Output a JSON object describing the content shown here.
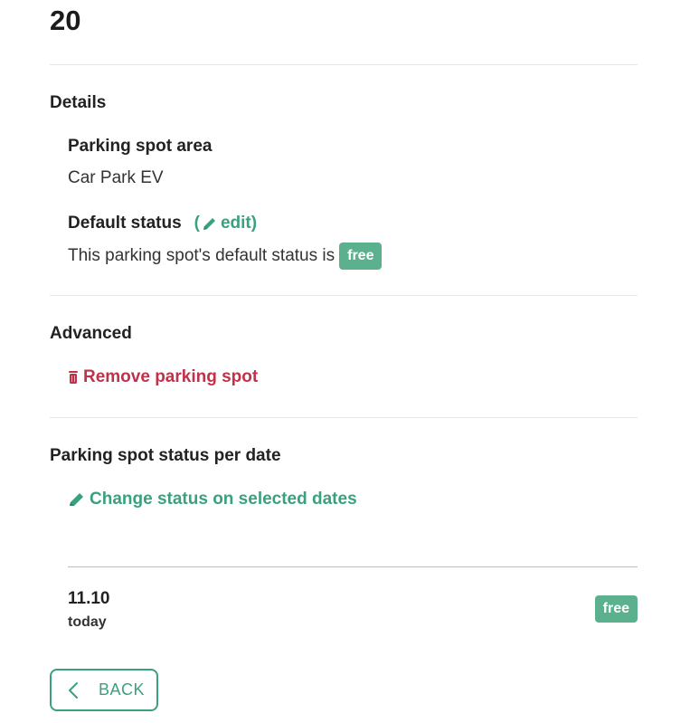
{
  "header": {
    "title": "20"
  },
  "details": {
    "section_title": "Details",
    "area_label": "Parking spot area",
    "area_value": "Car Park EV",
    "default_status_label": "Default status",
    "edit_open": "(",
    "edit_label": "edit)",
    "default_status_text": "This parking spot's default status is",
    "default_status_badge": "free"
  },
  "advanced": {
    "section_title": "Advanced",
    "remove_label": "Remove parking spot"
  },
  "status_per_date": {
    "section_title": "Parking spot status per date",
    "change_label": "Change status on selected dates",
    "dates": [
      {
        "date": "11.10",
        "sub": "today",
        "status": "free"
      }
    ]
  },
  "footer": {
    "back_label": "BACK"
  },
  "colors": {
    "accent": "#3aa17e",
    "badge": "#5bb08d",
    "danger": "#c0314a"
  }
}
